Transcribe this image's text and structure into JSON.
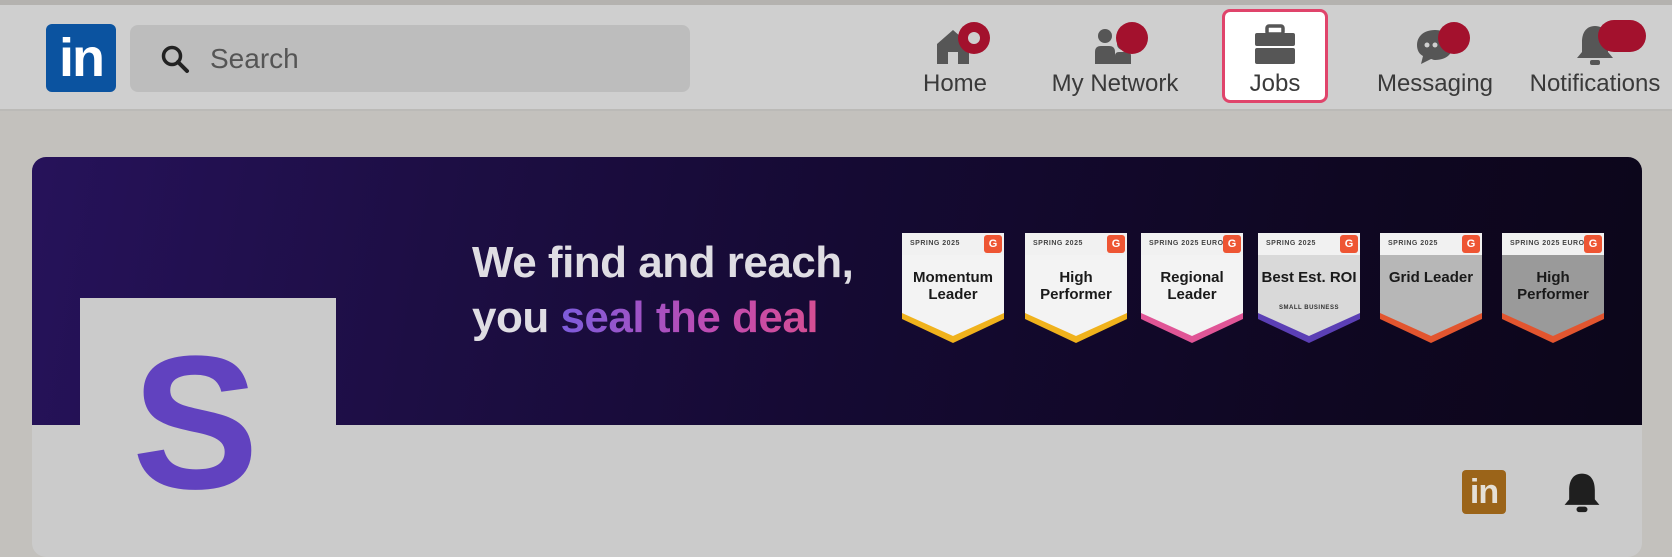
{
  "app": {
    "logo_text": "in"
  },
  "search": {
    "placeholder": "Search"
  },
  "nav": {
    "home": "Home",
    "network": "My Network",
    "jobs": "Jobs",
    "messaging": "Messaging",
    "notifications": "Notifications"
  },
  "banner": {
    "line1": "We find and reach,",
    "line2_prefix": "you ",
    "line2_highlight": "seal the deal",
    "badges": [
      {
        "season": "SPRING 2025",
        "title": "Momentum Leader",
        "sub": "",
        "accent": "#f0b21c"
      },
      {
        "season": "SPRING 2025",
        "title": "High Performer",
        "sub": "",
        "accent": "#f0b21c"
      },
      {
        "season": "SPRING 2025 EUROPE",
        "title": "Regional Leader",
        "sub": "",
        "accent": "#e05596"
      },
      {
        "season": "SPRING 2025",
        "title": "Best Est. ROI",
        "sub": "SMALL BUSINESS",
        "accent": "#5b3fb5"
      },
      {
        "season": "SPRING 2025",
        "title": "Grid Leader",
        "sub": "",
        "accent": "#e2552f"
      },
      {
        "season": "SPRING 2025 EUROPE",
        "title": "High Performer",
        "sub": "",
        "accent": "#e2552f"
      }
    ],
    "g2_mark": "G"
  },
  "company": {
    "avatar_letter": "S",
    "linkedin_button": "in"
  },
  "colors": {
    "accent_brand": "#0b53a0",
    "badge_red": "#a3112d",
    "jobs_highlight": "#e0446b",
    "avatar_purple": "#6142bf"
  }
}
